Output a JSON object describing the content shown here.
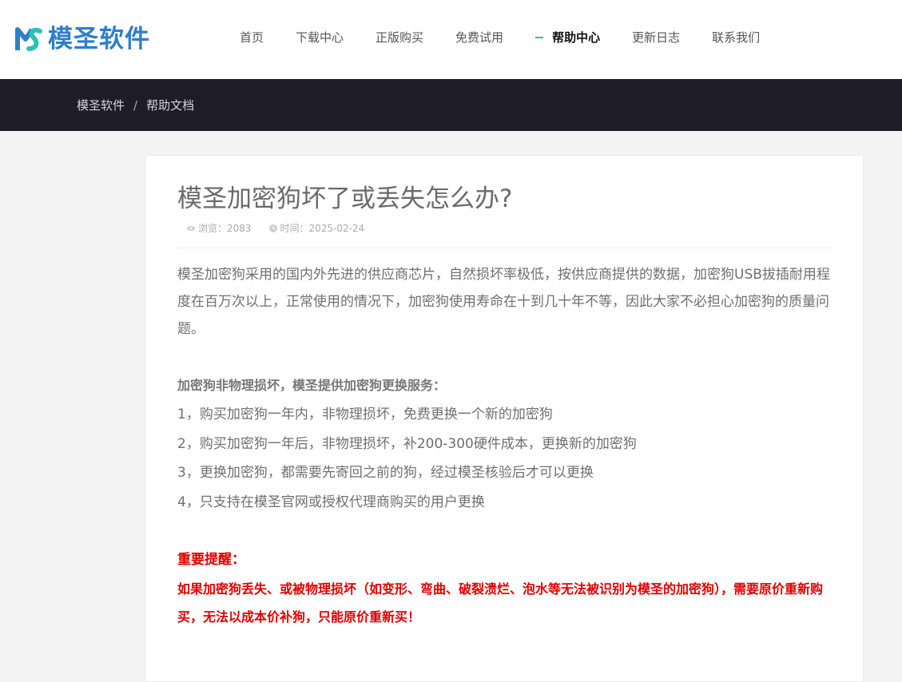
{
  "header": {
    "logo_text": "模圣软件",
    "nav": [
      {
        "label": "首页",
        "active": false
      },
      {
        "label": "下载中心",
        "active": false
      },
      {
        "label": "正版购买",
        "active": false
      },
      {
        "label": "免费试用",
        "active": false
      },
      {
        "label": "帮助中心",
        "active": true
      },
      {
        "label": "更新日志",
        "active": false
      },
      {
        "label": "联系我们",
        "active": false
      }
    ]
  },
  "breadcrumb": {
    "home": "模圣软件",
    "separator": "/",
    "current": "帮助文档"
  },
  "article": {
    "title": "模圣加密狗坏了或丢失怎么办?",
    "views_label": "浏览：2083",
    "date_label": "时间：2025-02-24",
    "intro": "模圣加密狗采用的国内外先进的供应商芯片，自然损坏率极低，按供应商提供的数据，加密狗USB拔插耐用程度在百万次以上，正常使用的情况下，加密狗使用寿命在十到几十年不等，因此大家不必担心加密狗的质量问题。",
    "service_heading": "加密狗非物理损坏，模圣提供加密狗更换服务：",
    "service_items": [
      "1，购买加密狗一年内，非物理损坏，免费更换一个新的加密狗",
      "2，购买加密狗一年后，非物理损坏，补200-300硬件成本，更换新的加密狗",
      "3，更换加密狗，都需要先寄回之前的狗，经过模圣核验后才可以更换",
      "4，只支持在模圣官网或授权代理商购买的用户更换"
    ],
    "warning_heading": "重要提醒：",
    "warning_text": "如果加密狗丢失、或被物理损坏（如变形、弯曲、破裂溃烂、泡水等无法被识别为模圣的加密狗），需要原价重新购买，无法以成本价补狗，只能原价重新买！"
  },
  "colors": {
    "brand": "#2f7ecb",
    "nav_accent": "#2bc0b9",
    "breadcrumb_bg": "#1d1c28",
    "warning": "#e00000"
  }
}
